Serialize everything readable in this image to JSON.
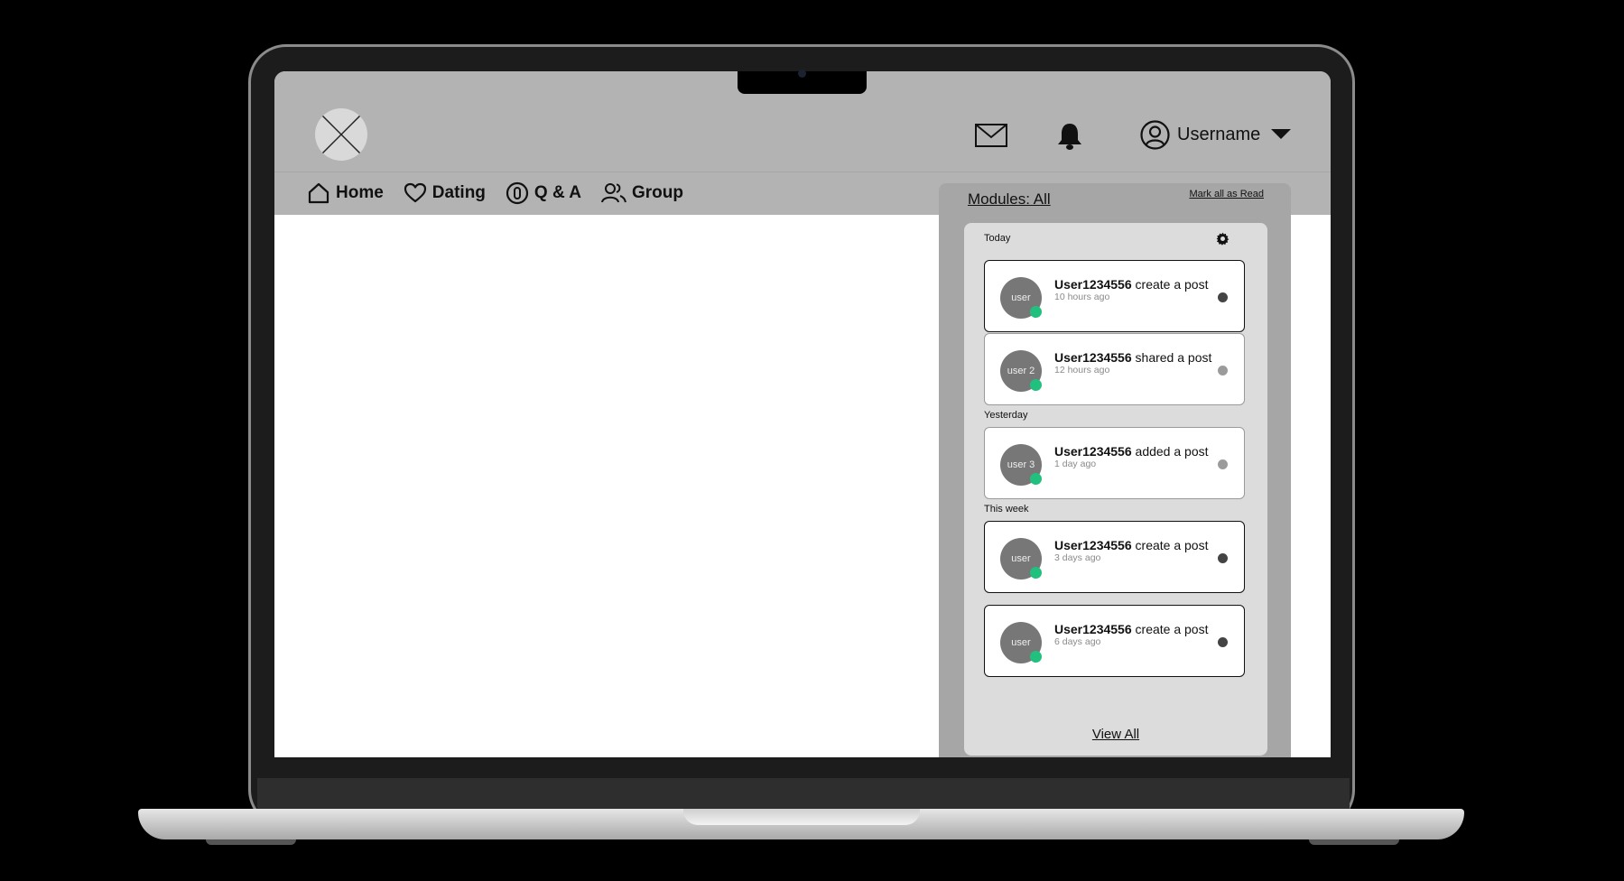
{
  "header": {
    "username": "Username",
    "icons": [
      "mail-icon",
      "bell-icon",
      "user-circle-icon",
      "caret-down-icon"
    ]
  },
  "nav": {
    "items": [
      {
        "label": "Home",
        "icon": "home-icon"
      },
      {
        "label": "Dating",
        "icon": "heart-icon"
      },
      {
        "label": "Q & A",
        "icon": "qa-icon"
      },
      {
        "label": "Group",
        "icon": "group-icon"
      }
    ]
  },
  "notifications": {
    "modules_label": "Modules: All",
    "mark_all_read": "Mark all as Read",
    "view_all": "View All",
    "sections": {
      "today": "Today",
      "yesterday": "Yesterday",
      "this_week": "This week"
    },
    "items": [
      {
        "avatar": "user",
        "user": "User1234556",
        "action": "create a post",
        "time": "10 hours ago",
        "unread": true
      },
      {
        "avatar": "user 2",
        "user": "User1234556",
        "action": "shared a post",
        "time": "12 hours ago",
        "unread": false
      },
      {
        "avatar": "user 3",
        "user": "User1234556",
        "action": "added a post",
        "time": "1 day ago",
        "unread": false
      },
      {
        "avatar": "user",
        "user": "User1234556",
        "action": "create a post",
        "time": "3 days ago",
        "unread": true
      },
      {
        "avatar": "user",
        "user": "User1234556",
        "action": "create a post",
        "time": "6 days ago",
        "unread": true
      }
    ]
  },
  "colors": {
    "header_bg": "#b3b3b3",
    "panel_bg": "#a6a6a6",
    "online": "#22c07e"
  }
}
